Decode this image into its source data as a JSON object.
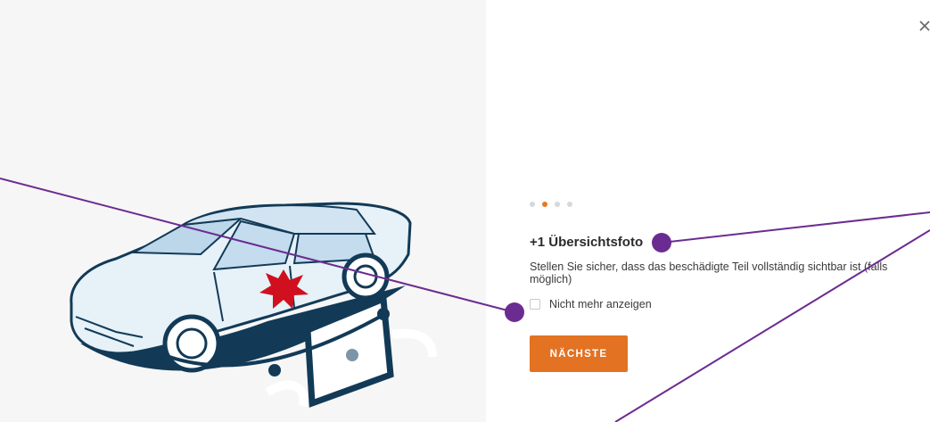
{
  "dialog": {
    "close_icon": "close-icon",
    "illustration": "car-photo-guide-illustration"
  },
  "pager": {
    "total": 4,
    "active_index": 1,
    "colors": {
      "active": "#e87722",
      "inactive": "#d5d8dc"
    }
  },
  "slide": {
    "title": "+1 Übersichtsfoto",
    "description": "Stellen Sie sicher, dass das beschädigte Teil vollständig sichtbar ist (falls möglich)",
    "checkbox_label": "Nicht mehr anzeigen",
    "checkbox_checked": false,
    "next_label": "NÄCHSTE"
  },
  "colors": {
    "accent": "#e37222",
    "annotation": "#6b2c91",
    "damage": "#d0101e",
    "car_outline": "#123a57",
    "car_fill": "#e6f1f8"
  }
}
